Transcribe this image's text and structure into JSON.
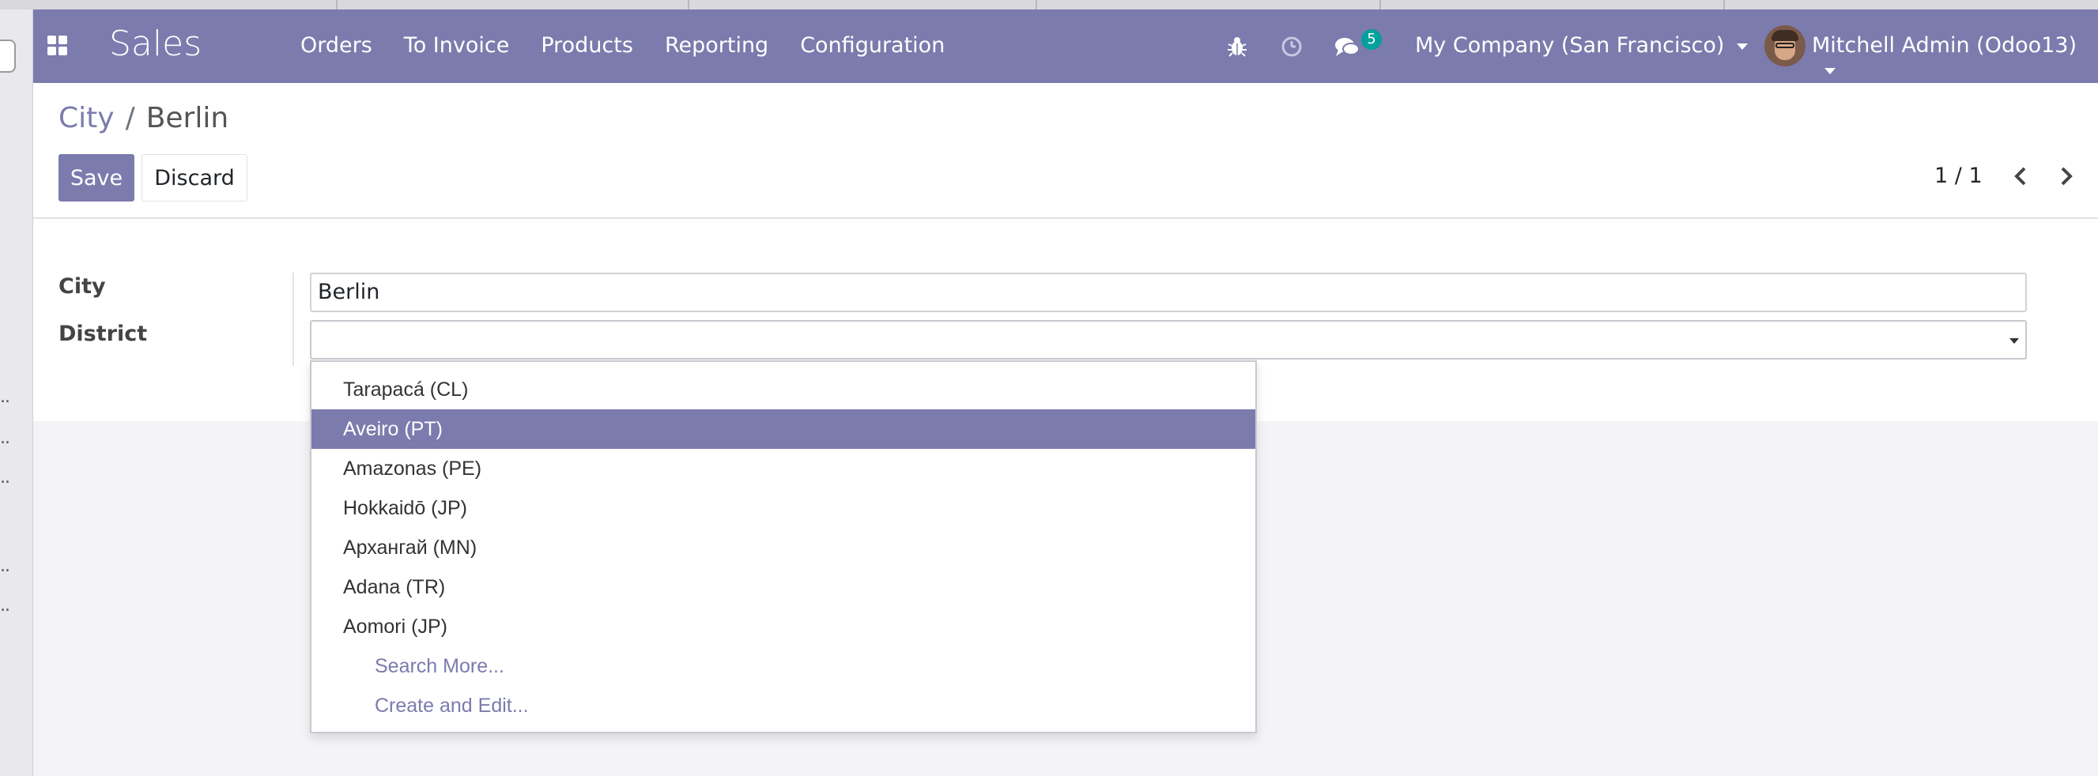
{
  "navbar": {
    "app_name": "Sales",
    "menu": [
      "Orders",
      "To Invoice",
      "Products",
      "Reporting",
      "Configuration"
    ],
    "messages_count": "5",
    "company": "My Company (San Francisco)",
    "user": "Mitchell Admin (Odoo13)"
  },
  "breadcrumb": {
    "parent": "City",
    "separator": "/",
    "current": "Berlin"
  },
  "actions": {
    "save_label": "Save",
    "discard_label": "Discard"
  },
  "pager": {
    "text": "1 / 1"
  },
  "form": {
    "city_label": "City",
    "city_value": "Berlin",
    "district_label": "District",
    "district_value": ""
  },
  "dropdown": {
    "items": [
      "Tarapacá (CL)",
      "Aveiro (PT)",
      "Amazonas (PE)",
      "Hokkaidō (JP)",
      "Архангай (MN)",
      "Adana (TR)",
      "Aomori (JP)"
    ],
    "active_index": 1,
    "search_more": "Search More...",
    "create_edit": "Create and Edit..."
  },
  "colors": {
    "brand": "#7c7bad",
    "badge": "#00a09d"
  }
}
